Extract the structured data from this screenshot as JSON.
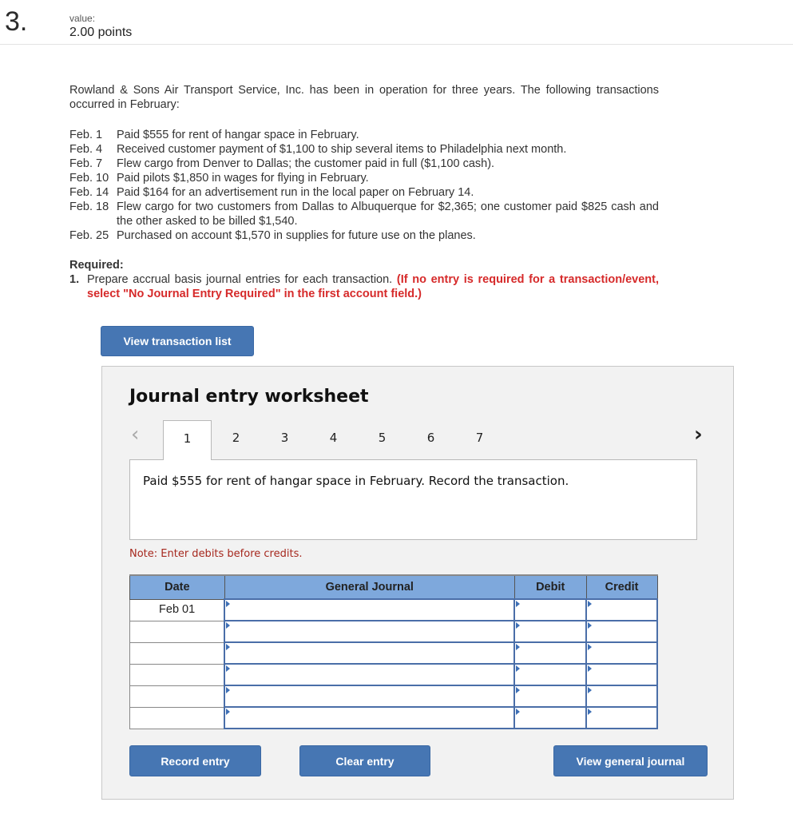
{
  "question": {
    "number": "3.",
    "value_label": "value:",
    "value": "2.00 points"
  },
  "problem": {
    "intro": "Rowland & Sons Air Transport Service, Inc. has been in operation for three years. The following transactions occurred in February:",
    "transactions": [
      {
        "date": "Feb. 1",
        "text": "Paid $555 for rent of hangar space in February."
      },
      {
        "date": "Feb. 4",
        "text": "Received customer payment of $1,100 to ship several items to Philadelphia next month."
      },
      {
        "date": "Feb. 7",
        "text": "Flew cargo from Denver to Dallas; the customer paid in full ($1,100 cash)."
      },
      {
        "date": "Feb. 10",
        "text": "Paid pilots $1,850 in wages for flying in February."
      },
      {
        "date": "Feb. 14",
        "text": "Paid $164 for an advertisement run in the local paper on February 14."
      },
      {
        "date": "Feb. 18",
        "text": "Flew cargo for two customers from Dallas to Albuquerque for $2,365; one customer paid $825 cash and the other asked to be billed $1,540."
      },
      {
        "date": "Feb. 25",
        "text": "Purchased on account $1,570 in supplies for future use on the planes."
      }
    ],
    "required_label": "Required:",
    "required_number": "1.",
    "required_text": "Prepare accrual basis journal entries for each transaction.",
    "required_instruction": "(If no entry is required for a transaction/event, select \"No Journal Entry Required\" in the first account field.)"
  },
  "buttons": {
    "view_transaction_list": "View transaction list",
    "record_entry": "Record entry",
    "clear_entry": "Clear entry",
    "view_general_journal": "View general journal"
  },
  "worksheet": {
    "title": "Journal entry worksheet",
    "prev_icon": "‹",
    "next_icon": "›",
    "tabs": [
      "1",
      "2",
      "3",
      "4",
      "5",
      "6",
      "7"
    ],
    "active_tab": "1",
    "prompt": "Paid $555 for rent of hangar space in February. Record the transaction.",
    "note": "Note: Enter debits before credits."
  },
  "journal": {
    "headers": {
      "date": "Date",
      "general_journal": "General Journal",
      "debit": "Debit",
      "credit": "Credit"
    },
    "rows": [
      {
        "date": "Feb 01",
        "account": "",
        "debit": "",
        "credit": ""
      },
      {
        "date": "",
        "account": "",
        "debit": "",
        "credit": ""
      },
      {
        "date": "",
        "account": "",
        "debit": "",
        "credit": ""
      },
      {
        "date": "",
        "account": "",
        "debit": "",
        "credit": ""
      },
      {
        "date": "",
        "account": "",
        "debit": "",
        "credit": ""
      },
      {
        "date": "",
        "account": "",
        "debit": "",
        "credit": ""
      }
    ]
  },
  "colors": {
    "button_blue": "#4676b3",
    "header_blue": "#7ea8dc",
    "instruction_red": "#d62a2a",
    "note_red": "#a6281e"
  }
}
